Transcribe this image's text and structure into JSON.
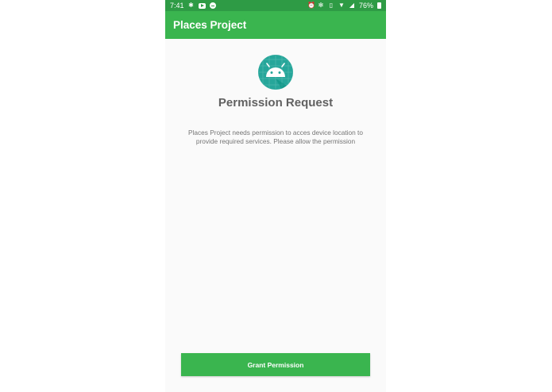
{
  "status_bar": {
    "time": "7:41",
    "battery": "76%",
    "left_icons": [
      "slack-icon",
      "youtube-icon",
      "messenger-icon"
    ],
    "right_icons": [
      "alarm-icon",
      "bluetooth-icon",
      "vibrate-icon",
      "wifi-icon",
      "signal-icon",
      "battery-icon"
    ]
  },
  "app_bar": {
    "title": "Places Project",
    "color": "#3ab54f"
  },
  "permission": {
    "icon": "android-icon",
    "title": "Permission Request",
    "message": "Places Project needs permission to acces device location to provide required services. Please allow the permission"
  },
  "actions": {
    "grant_label": "Grant Permission"
  },
  "colors": {
    "status_bar": "#2e9b45",
    "primary": "#3ab54f",
    "icon_background": "#26a69a"
  }
}
